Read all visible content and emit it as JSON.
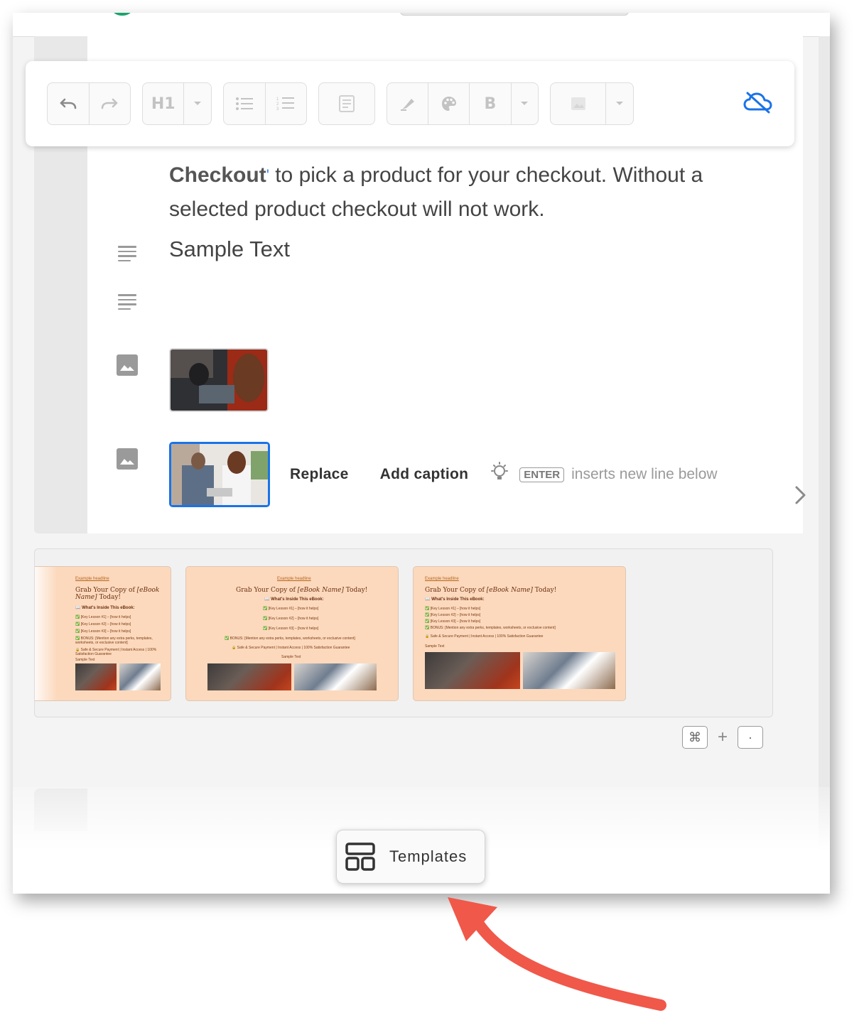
{
  "toolbar": {
    "undo": "undo-icon",
    "redo": "redo-icon",
    "heading": "H1",
    "bold": "B",
    "sync_status_icon": "cloud-off-icon"
  },
  "editor": {
    "checkout_bold": "Checkout",
    "checkout_text_1": " to pick a product for your checkout. Without a",
    "checkout_text_2": "selected product checkout will not work.",
    "sample_text": "Sample Text"
  },
  "image_actions": {
    "replace": "Replace",
    "add_caption": "Add caption",
    "enter_key": "ENTER",
    "hint": "inserts new line below"
  },
  "template_cards": [
    {
      "example": "Example headline",
      "title_prefix": "Grab Your Copy of ",
      "title_em": "[eBook Name]",
      "title_suffix": " Today!",
      "whats_inside": "📖 What's Inside This eBook:",
      "items": [
        "✅ [Key Lesson #1] – [how it helps]",
        "✅ [Key Lesson #2] – [how it helps]",
        "✅ [Key Lesson #3] – [how it helps]",
        "✅ BONUS: [Mention any extra perks, templates, worksheets, or exclusive content]"
      ],
      "footer": "🔒 Safe & Secure Payment | Instant Access | 100% Satisfaction Guarantee",
      "sample": "Sample Text"
    }
  ],
  "shortcut": {
    "cmd": "⌘",
    "plus": "+",
    "key": "·"
  },
  "templates_button": {
    "label": "Templates",
    "icon": "layout-icon"
  },
  "colors": {
    "accent": "#1a73e8",
    "card_bg": "#fcd9bd",
    "annotation_arrow": "#f0584a"
  }
}
